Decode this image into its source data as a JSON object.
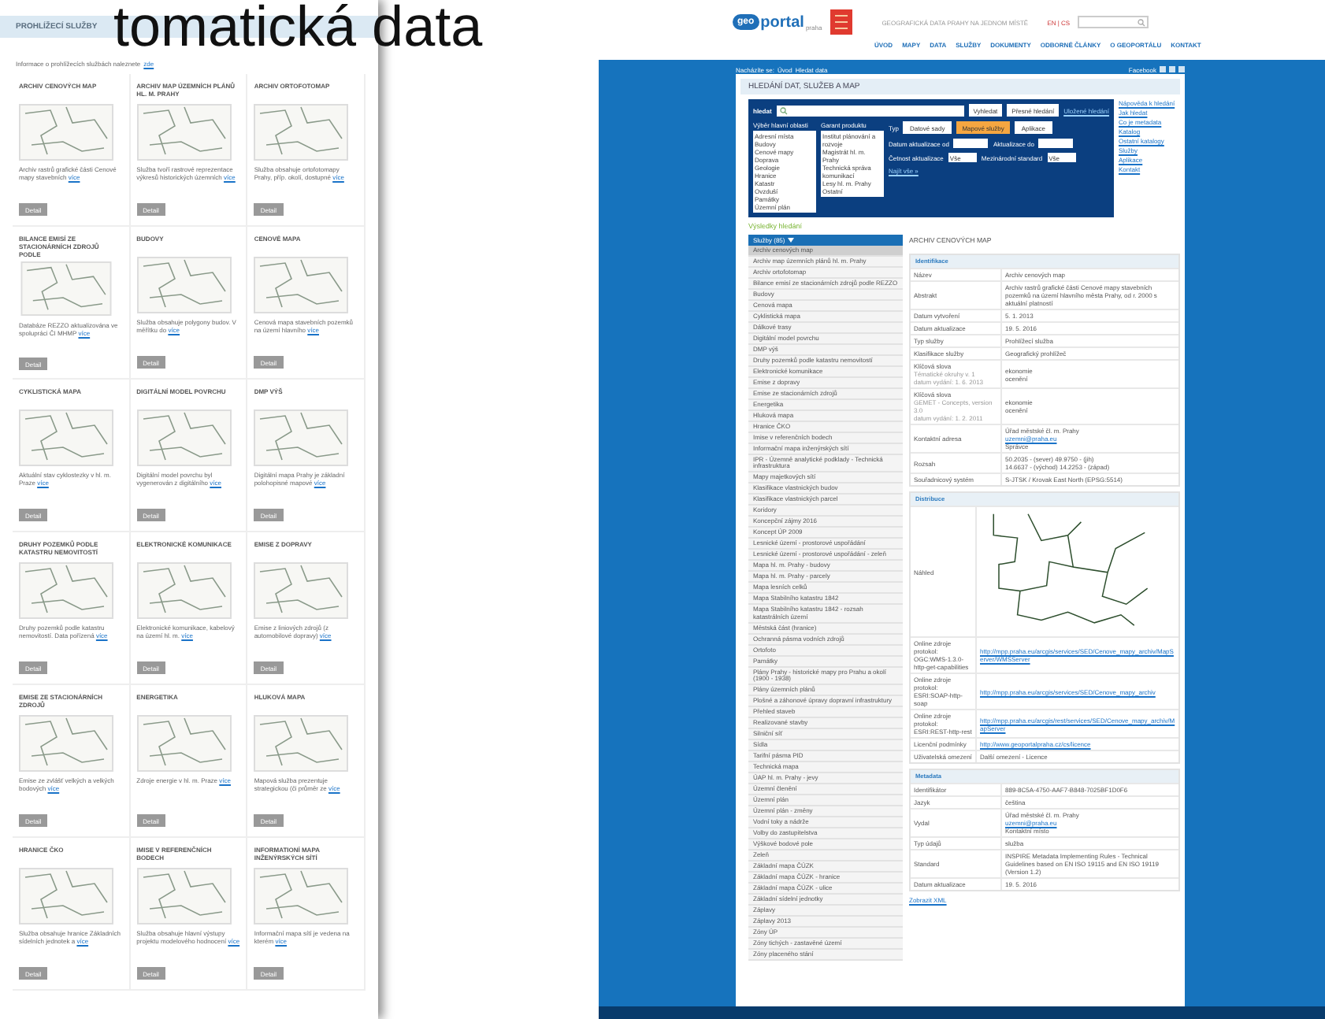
{
  "slide_title": "tomatická data",
  "services": {
    "header": "PROHLÍŽECÍ SLUŽBY",
    "intro": "Informace o prohlížecích službách naleznete",
    "intro_link": "zde",
    "cards": [
      {
        "title": "ARCHIV CENOVÝCH MAP",
        "description": "Archiv rastrů grafické části Cenové mapy stavebních",
        "link": "více",
        "button": "Detail"
      },
      {
        "title": "ARCHIV MAP ÚZEMNÍCH PLÁNŮ HL. M. PRAHY",
        "description": "Služba tvoří rastrové reprezentace výkresů historických územních",
        "link": "více",
        "button": "Detail"
      },
      {
        "title": "ARCHIV ORTOFOTOMAP",
        "description": "Služba obsahuje ortofotomapy Prahy, příp. okolí, dostupné",
        "link": "více",
        "button": "Detail"
      },
      {
        "title": "BILANCE EMISÍ ZE STACIONÁRNÍCH ZDROJŮ PODLE",
        "description": "Databáze REZZO aktualizována ve spolupráci ČI MHMP",
        "link": "více",
        "button": "Detail"
      },
      {
        "title": "BUDOVY",
        "description": "Služba obsahuje polygony budov. V měřítku do",
        "link": "více",
        "button": "Detail"
      },
      {
        "title": "CENOVÉ MAPA",
        "description": "Cenová mapa stavebních pozemků na území hlavního",
        "link": "více",
        "button": "Detail"
      },
      {
        "title": "CYKLISTICKÁ MAPA",
        "description": "Aktuální stav cyklostezky v hl. m. Praze",
        "link": "více",
        "button": "Detail"
      },
      {
        "title": "DIGITÁLNÍ MODEL POVRCHU",
        "description": "Digitální model povrchu byl vygenerován z digitálního",
        "link": "více",
        "button": "Detail"
      },
      {
        "title": "DMP VÝŠ",
        "description": "Digitální mapa Prahy je základní polohopisné mapové",
        "link": "více",
        "button": "Detail"
      },
      {
        "title": "DRUHY POZEMKŮ PODLE KATASTRU NEMOVITOSTÍ",
        "description": "Druhy pozemků podle katastru nemovitostí. Data pořízená",
        "link": "více",
        "button": "Detail"
      },
      {
        "title": "ELEKTRONICKÉ KOMUNIKACE",
        "description": "Elektronické komunikace, kabelový na území hl. m.",
        "link": "více",
        "button": "Detail"
      },
      {
        "title": "EMISE Z DOPRAVY",
        "description": "Emise z liniových zdrojů (z automobilové dopravy)",
        "link": "více",
        "button": "Detail"
      },
      {
        "title": "EMISE ZE STACIONÁRNÍCH ZDROJŮ",
        "description": "Emise ze zvlášť velkých a velkých bodových",
        "link": "více",
        "button": "Detail"
      },
      {
        "title": "ENERGETIKA",
        "description": "Zdroje energie v hl. m. Praze",
        "link": "více",
        "button": "Detail"
      },
      {
        "title": "HLUKOVÁ MAPA",
        "description": "Mapová služba prezentuje strategickou (či průměr ze",
        "link": "více",
        "button": "Detail"
      },
      {
        "title": "HRANICE ČKO",
        "description": "Služba obsahuje hranice Základních sídelních jednotek a",
        "link": "více",
        "button": "Detail"
      },
      {
        "title": "IMISE V REFERENČNÍCH BODECH",
        "description": "Služba obsahuje hlavní výstupy projektu modelového hodnocení",
        "link": "více",
        "button": "Detail"
      },
      {
        "title": "INFORMATIONÍ MAPA INŽENÝRSKÝCH SÍTÍ",
        "description": "Informační mapa sítí je vedena na kterém",
        "link": "více",
        "button": "Detail"
      }
    ]
  },
  "portal": {
    "logo_badge": "geo",
    "logo_text": "portal",
    "logo_sub": "praha",
    "tagline": "GEOGRAFICKÁ DATA PRAHY NA JEDNOM MÍSTĚ",
    "lang": "EN | CS",
    "nav": [
      "ÚVOD",
      "MAPY",
      "DATA",
      "SLUŽBY",
      "DOKUMENTY",
      "ODBORNÉ ČLÁNKY",
      "O GEOPORTÁLU",
      "KONTAKT"
    ],
    "breadcrumb_label": "Nacházíte se:",
    "breadcrumb": [
      "Úvod",
      "Hledat data"
    ],
    "social": "Facebook",
    "page_title": "HLEDÁNÍ DAT, SLUŽEB A MAP",
    "search": {
      "brand": "hledat",
      "buttons": [
        "Vyhledat",
        "Přesné hledání"
      ],
      "saved_link": "Uložené hledání",
      "lists": [
        {
          "label": "Výběr hlavní oblasti",
          "items": [
            "Adresní místa",
            "Budovy",
            "Cenové mapy",
            "Doprava",
            "Geologie",
            "Hranice",
            "Katastr",
            "Ovzduší",
            "Památky",
            "Územní plán"
          ]
        },
        {
          "label": "Garant produktu",
          "items": [
            "Institut plánování a rozvoje",
            "Magistrát hl. m. Prahy",
            "Technická správa komunikací",
            "Lesy hl. m. Prahy",
            "Ostatní"
          ]
        }
      ],
      "type_label": "Typ",
      "types": [
        {
          "label": "Datové sady",
          "selected": false
        },
        {
          "label": "Mapové služby",
          "selected": true
        },
        {
          "label": "Aplikace",
          "selected": false
        }
      ],
      "date_from": "Datum aktualizace od",
      "date_to": "Aktualizace do",
      "frequency": "Četnost aktualizace",
      "frequency_value": "Vše",
      "standard": "Mezinárodní standard",
      "standard_value": "Vše",
      "find_all": "Najít vše »"
    },
    "help_links": [
      "Nápověda k hledání",
      "Jak hledat",
      "Co je metadata",
      "Katalog",
      "Ostatní katalogy",
      "Služby",
      "Aplikace",
      "Kontakt"
    ],
    "results": {
      "title": "Výsledky hledání",
      "group": "Služby (85)",
      "items": [
        {
          "label": "Archiv cenových map",
          "selected": true
        },
        {
          "label": "Archiv map územních plánů hl. m. Prahy",
          "selected": false
        },
        {
          "label": "Archiv ortofotomap",
          "selected": false
        },
        {
          "label": "Bilance emisí ze stacionárních zdrojů podle REZZO",
          "selected": false
        },
        {
          "label": "Budovy",
          "selected": false
        },
        {
          "label": "Cenová mapa",
          "selected": false
        },
        {
          "label": "Cyklistická mapa",
          "selected": false
        },
        {
          "label": "Dálkové trasy",
          "selected": false
        },
        {
          "label": "Digitální model povrchu",
          "selected": false
        },
        {
          "label": "DMP výš",
          "selected": false
        },
        {
          "label": "Druhy pozemků podle katastru nemovitostí",
          "selected": false
        },
        {
          "label": "Elektronické komunikace",
          "selected": false
        },
        {
          "label": "Emise z dopravy",
          "selected": false
        },
        {
          "label": "Emise ze stacionárních zdrojů",
          "selected": false
        },
        {
          "label": "Energetika",
          "selected": false
        },
        {
          "label": "Hluková mapa",
          "selected": false
        },
        {
          "label": "Hranice ČKO",
          "selected": false
        },
        {
          "label": "Imise v referenčních bodech",
          "selected": false
        },
        {
          "label": "Informační mapa inženýrských sítí",
          "selected": false
        },
        {
          "label": "IPR - Územně analytické podklady - Technická infrastruktura",
          "selected": false
        },
        {
          "label": "Mapy majetkových sítí",
          "selected": false
        },
        {
          "label": "Klasifikace vlastnických budov",
          "selected": false
        },
        {
          "label": "Klasifikace vlastnických parcel",
          "selected": false
        },
        {
          "label": "Koridory",
          "selected": false
        },
        {
          "label": "Koncepční zájmy 2016",
          "selected": false
        },
        {
          "label": "Koncept ÚP 2009",
          "selected": false
        },
        {
          "label": "Lesnické území - prostorové uspořádání",
          "selected": false
        },
        {
          "label": "Lesnické území - prostorové uspořádání - zeleň",
          "selected": false
        },
        {
          "label": "Mapa hl. m. Prahy - budovy",
          "selected": false
        },
        {
          "label": "Mapa hl. m. Prahy - parcely",
          "selected": false
        },
        {
          "label": "Mapa lesních celků",
          "selected": false
        },
        {
          "label": "Mapa Stabilního katastru 1842",
          "selected": false
        },
        {
          "label": "Mapa Stabilního katastru 1842 - rozsah katastrálních území",
          "selected": false
        },
        {
          "label": "Městská část (hranice)",
          "selected": false
        },
        {
          "label": "Ochranná pásma vodních zdrojů",
          "selected": false
        },
        {
          "label": "Ortofoto",
          "selected": false
        },
        {
          "label": "Památky",
          "selected": false
        },
        {
          "label": "Plány Prahy - historické mapy pro Prahu a okolí (1900 - 1938)",
          "selected": false
        },
        {
          "label": "Plány územních plánů",
          "selected": false
        },
        {
          "label": "Plošné a záhonové úpravy dopravní infrastruktury",
          "selected": false
        },
        {
          "label": "Přehled staveb",
          "selected": false
        },
        {
          "label": "Realizované stavby",
          "selected": false
        },
        {
          "label": "Silniční síť",
          "selected": false
        },
        {
          "label": "Sídla",
          "selected": false
        },
        {
          "label": "Tarifní pásma PID",
          "selected": false
        },
        {
          "label": "Technická mapa",
          "selected": false
        },
        {
          "label": "ÚAP hl. m. Prahy - jevy",
          "selected": false
        },
        {
          "label": "Územní členění",
          "selected": false
        },
        {
          "label": "Územní plán",
          "selected": false
        },
        {
          "label": "Územní plán - změny",
          "selected": false
        },
        {
          "label": "Vodní toky a nádrže",
          "selected": false
        },
        {
          "label": "Volby do zastupitelstva",
          "selected": false
        },
        {
          "label": "Výškové bodové pole",
          "selected": false
        },
        {
          "label": "Zeleň",
          "selected": false
        },
        {
          "label": "Základní mapa ČÚZK",
          "selected": false
        },
        {
          "label": "Základní mapa ČÚZK - hranice",
          "selected": false
        },
        {
          "label": "Základní mapa ČÚZK - ulice",
          "selected": false
        },
        {
          "label": "Základní sídelní jednotky",
          "selected": false
        },
        {
          "label": "Záplavy",
          "selected": false
        },
        {
          "label": "Záplavy 2013",
          "selected": false
        },
        {
          "label": "Zóny ÚP",
          "selected": false
        },
        {
          "label": "Zóny tichých - zastavěné území",
          "selected": false
        },
        {
          "label": "Zóny placeného stání",
          "selected": false
        }
      ]
    },
    "detail": {
      "title": "ARCHIV CENOVÝCH MAP",
      "sections": [
        {
          "title": "Identifikace",
          "rows": [
            {
              "label": "Název",
              "values": [
                {
                  "kind": "text",
                  "text": "Archiv cenových map"
                }
              ]
            },
            {
              "label": "Abstrakt",
              "values": [
                {
                  "kind": "text",
                  "text": "Archiv rastrů grafické části Cenové mapy stavebních pozemků na území hlavního města Prahy, od r. 2000 s aktuální platností"
                }
              ]
            },
            {
              "label": "Datum vytvoření",
              "values": [
                {
                  "kind": "text",
                  "text": "5. 1. 2013"
                }
              ]
            },
            {
              "label": "Datum aktualizace",
              "values": [
                {
                  "kind": "text",
                  "text": "19. 5. 2016"
                }
              ]
            },
            {
              "label": "Typ služby",
              "values": [
                {
                  "kind": "text",
                  "text": "Prohlížecí služba"
                }
              ]
            },
            {
              "label": "Klasifikace služby",
              "values": [
                {
                  "kind": "text",
                  "text": "Geografický prohlížeč"
                }
              ]
            },
            {
              "label": "Klíčová slova",
              "notes": [
                "Tématické okruhy v. 1",
                "datum vydání: 1. 6. 2013"
              ],
              "values": [
                {
                  "kind": "text",
                  "text": "ekonomie"
                },
                {
                  "kind": "text",
                  "text": "ocenění"
                }
              ]
            },
            {
              "label": "Klíčová slova",
              "notes": [
                "GEMET - Concepts, version 3.0",
                "datum vydání: 1. 2. 2011"
              ],
              "values": [
                {
                  "kind": "text",
                  "text": "ekonomie"
                },
                {
                  "kind": "text",
                  "text": "ocenění"
                }
              ]
            },
            {
              "label": "Kontaktní adresa",
              "values": [
                {
                  "kind": "text",
                  "text": "Úřad městské čl. m. Prahy"
                },
                {
                  "kind": "link",
                  "text": "uzemni@praha.eu"
                },
                {
                  "kind": "text",
                  "text": "Správce"
                }
              ]
            },
            {
              "label": "Rozsah",
              "values": [
                {
                  "kind": "text",
                  "text": "50.2035 - (sever) 49.9750 - (jih)"
                },
                {
                  "kind": "text",
                  "text": "14.6637 - (východ) 14.2253 - (západ)"
                }
              ]
            },
            {
              "label": "Souřadnicový systém",
              "values": [
                {
                  "kind": "text",
                  "text": "S-JTSK / Krovak East North (EPSG:5514)"
                }
              ]
            }
          ]
        },
        {
          "title": "Distribuce",
          "rows": [
            {
              "label": "Náhled",
              "values": [
                {
                  "kind": "image"
                }
              ]
            },
            {
              "label": "Online zdroje protokol: OGC:WMS-1.3.0-http-get-capabilities",
              "values": [
                {
                  "kind": "link",
                  "text": "http://mpp.praha.eu/arcgis/services/SED/Cenove_mapy_archiv/MapServer/WMSServer"
                }
              ]
            },
            {
              "label": "Online zdroje protokol: ESRI:SOAP-http-soap",
              "values": [
                {
                  "kind": "link",
                  "text": "http://mpp.praha.eu/arcgis/services/SED/Cenove_mapy_archiv"
                }
              ]
            },
            {
              "label": "Online zdroje protokol: ESRI:REST-http-rest",
              "values": [
                {
                  "kind": "link",
                  "text": "http://mpp.praha.eu/arcgis/rest/services/SED/Cenove_mapy_archiv/MapServer"
                }
              ]
            },
            {
              "label": "Licenční podmínky",
              "values": [
                {
                  "kind": "link",
                  "text": "http://www.geoportalpraha.cz/cs/licence"
                }
              ]
            },
            {
              "label": "Uživatelská omezení",
              "values": [
                {
                  "kind": "text",
                  "text": "Další omezení - Licence"
                }
              ]
            }
          ]
        },
        {
          "title": "Metadata",
          "rows": [
            {
              "label": "Identifikátor",
              "values": [
                {
                  "kind": "text",
                  "text": "889-8C5A-4750-AAF7-B848-7025BF1D0F6"
                }
              ]
            },
            {
              "label": "Jazyk",
              "values": [
                {
                  "kind": "text",
                  "text": "čeština"
                }
              ]
            },
            {
              "label": "Vydal",
              "values": [
                {
                  "kind": "text",
                  "text": "Úřad městské čl. m. Prahy"
                },
                {
                  "kind": "link",
                  "text": "uzemni@praha.eu"
                },
                {
                  "kind": "text",
                  "text": "Kontaktní místo"
                }
              ]
            },
            {
              "label": "Typ údajů",
              "values": [
                {
                  "kind": "text",
                  "text": "služba"
                }
              ]
            },
            {
              "label": "Standard",
              "values": [
                {
                  "kind": "text",
                  "text": "INSPIRE Metadata Implementing Rules - Technical Guidelines based on EN ISO 19115 and EN ISO 19119 (Version 1.2)"
                }
              ]
            },
            {
              "label": "Datum aktualizace",
              "values": [
                {
                  "kind": "text",
                  "text": "19. 5. 2016"
                }
              ]
            }
          ]
        }
      ],
      "xml_link": "Zobrazit XML"
    }
  }
}
